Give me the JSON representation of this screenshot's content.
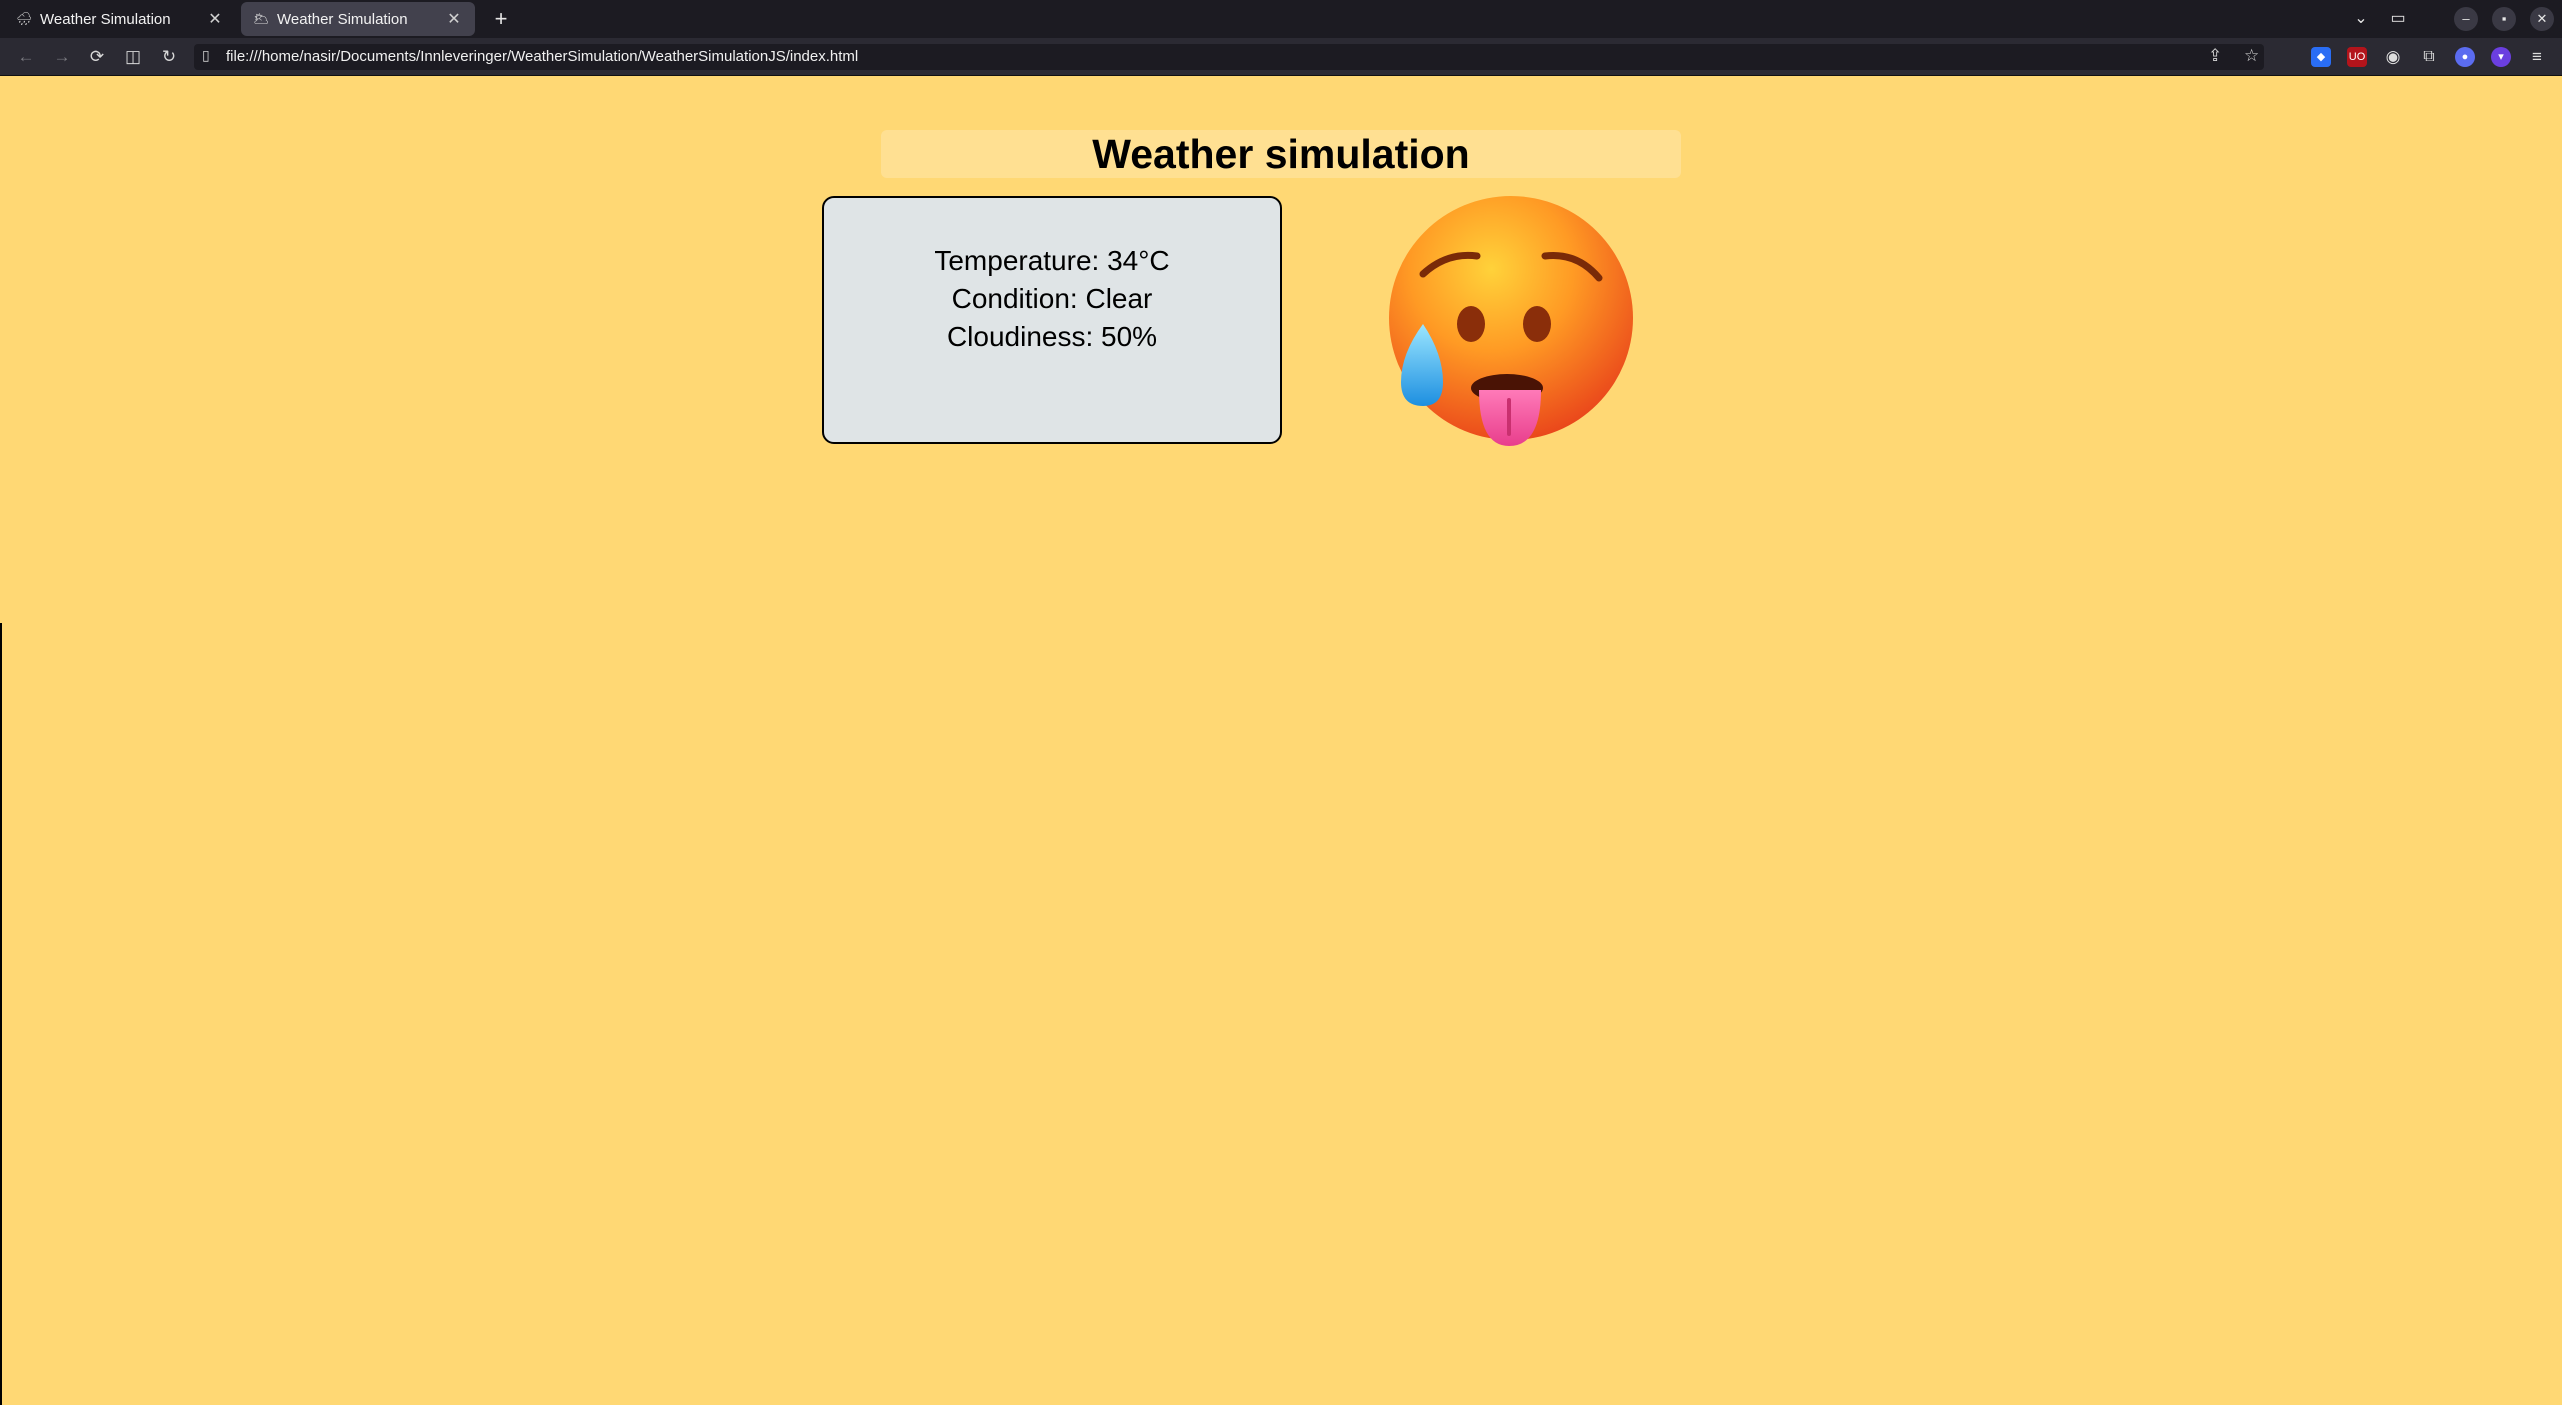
{
  "browser": {
    "tabs": [
      {
        "icon": "🌧",
        "title": "Weather Simulation",
        "close": "✕"
      },
      {
        "icon": "🌥",
        "title": "Weather Simulation",
        "close": "✕"
      }
    ],
    "new_tab": "+",
    "url": "file:///home/nasir/Documents/Innleveringer/WeatherSimulation/WeatherSimulationJS/index.html",
    "extension_badge": "UO"
  },
  "page": {
    "title": "Weather simulation",
    "temperature": "Temperature: 34°C",
    "condition": "Condition: Clear",
    "cloudiness": "Cloudiness: 50%",
    "emoji_icon": "hot-face-emoji"
  },
  "colors": {
    "background": "#ffd874",
    "card": "#dfe4e6"
  }
}
